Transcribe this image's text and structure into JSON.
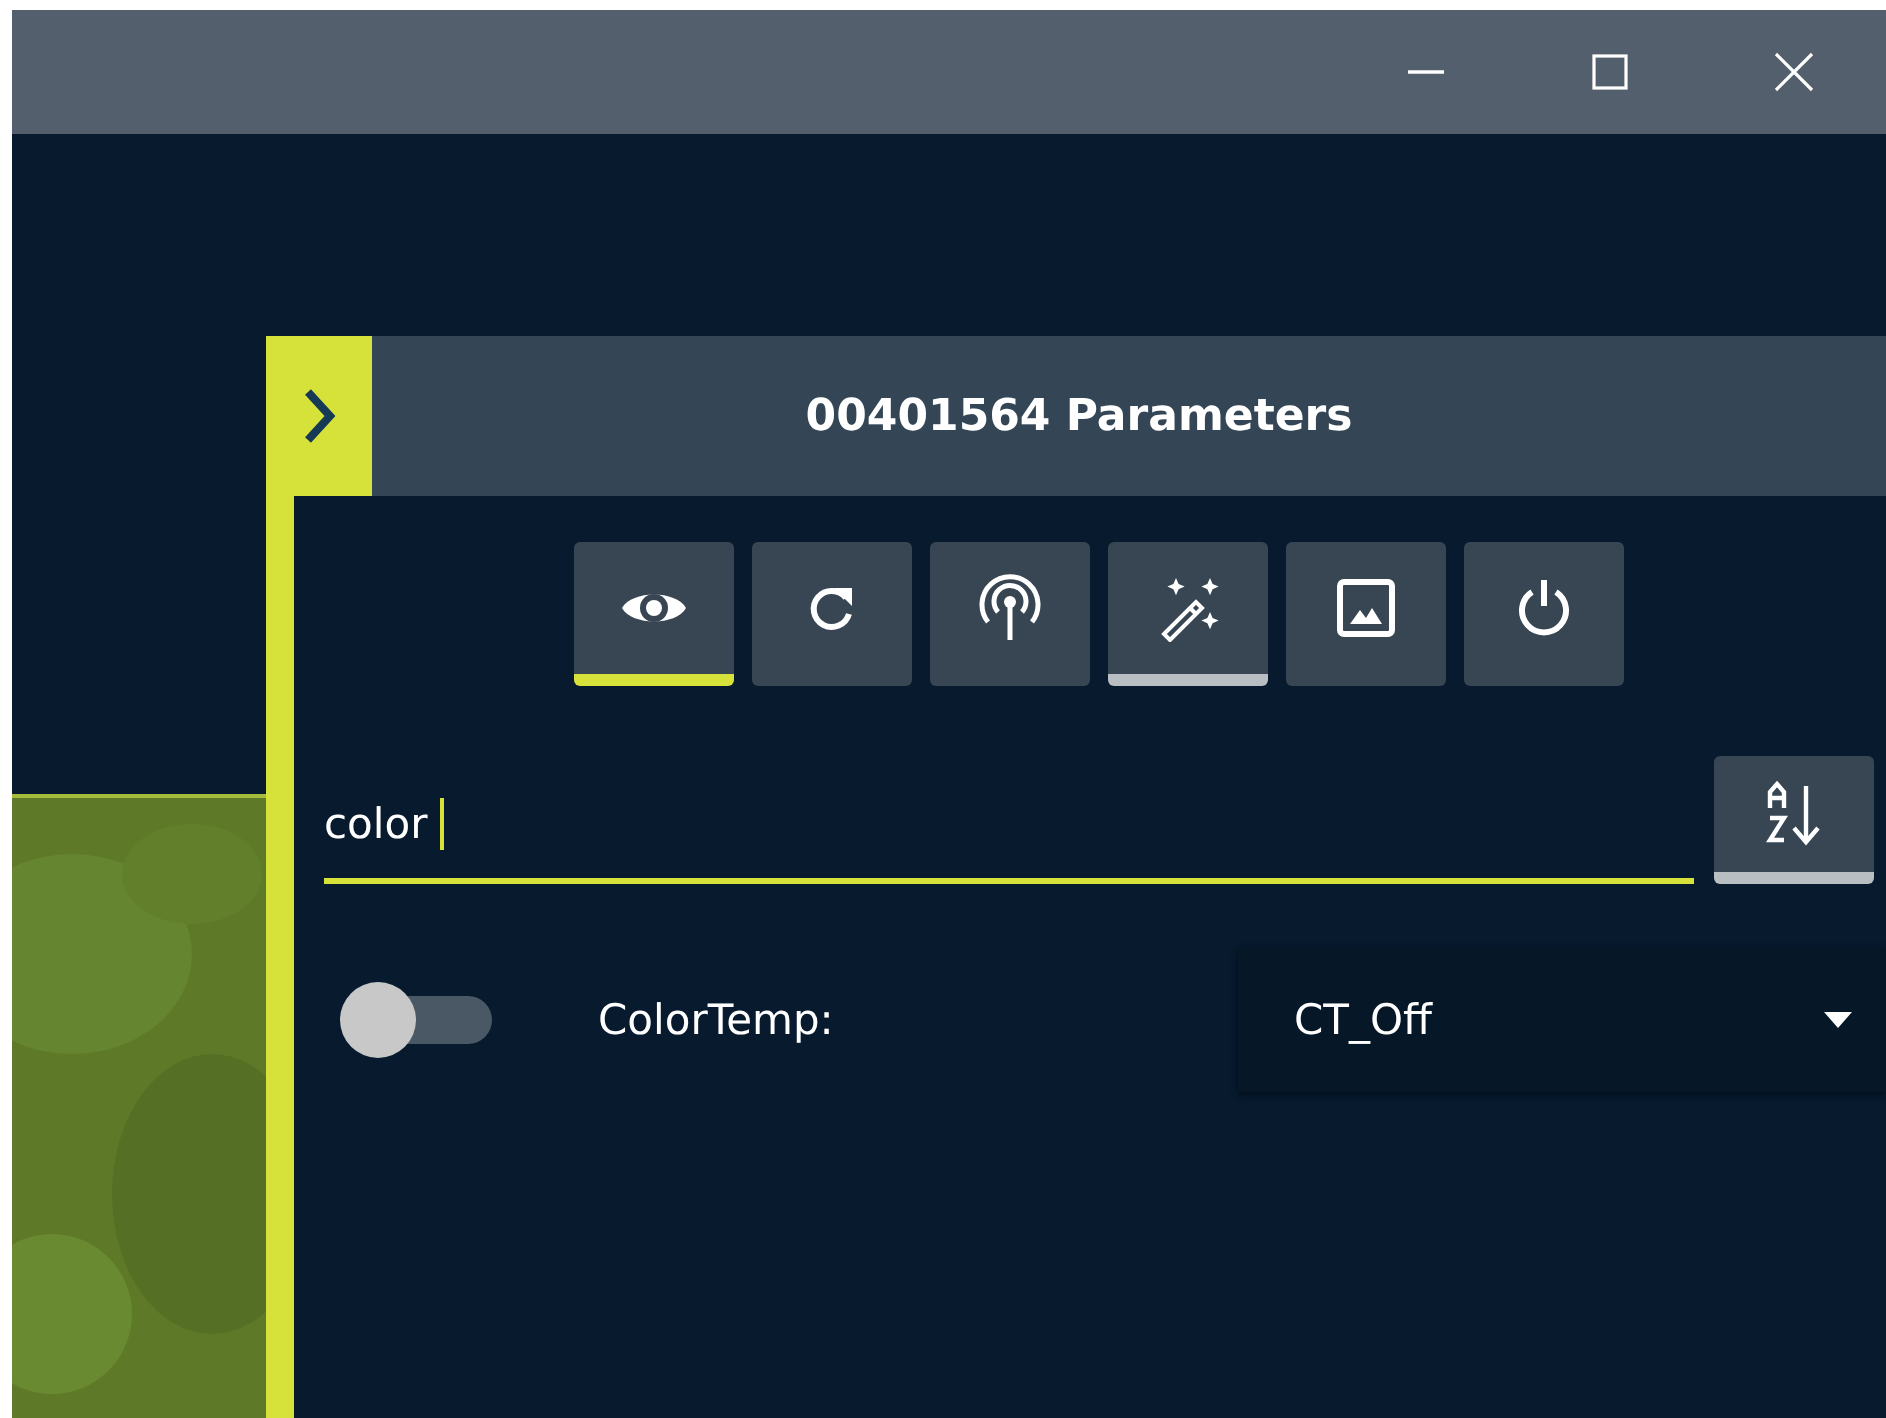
{
  "window": {
    "controls": [
      {
        "kind": "minimize"
      },
      {
        "kind": "maximize"
      },
      {
        "kind": "close"
      }
    ]
  },
  "panel": {
    "title": "00401564 Parameters",
    "toolbar": [
      {
        "selected": true,
        "highlighted": false
      },
      {
        "selected": false,
        "highlighted": false
      },
      {
        "selected": false,
        "highlighted": false
      },
      {
        "selected": false,
        "highlighted": true
      },
      {
        "selected": false,
        "highlighted": false
      },
      {
        "selected": false,
        "highlighted": false
      }
    ],
    "search": {
      "value": "color",
      "focused": true
    },
    "parameters": [
      {
        "on": false,
        "label": "ColorTemp:",
        "value": "CT_Off"
      }
    ]
  }
}
